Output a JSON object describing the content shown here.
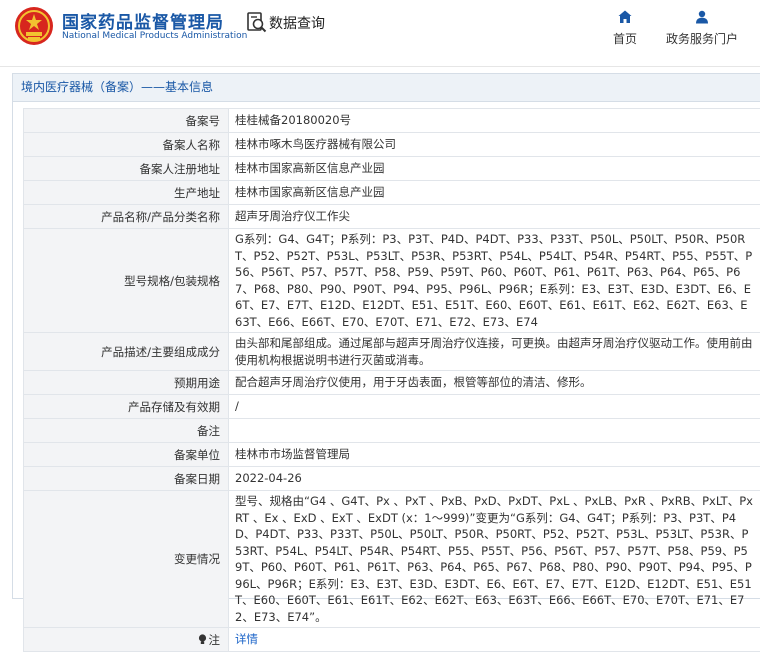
{
  "header": {
    "org_name_cn": "国家药品监督管理局",
    "org_name_en": "National Medical Products Administration",
    "search_label": "数据查询",
    "nav": [
      {
        "label": "首页"
      },
      {
        "label": "政务服务门户"
      }
    ]
  },
  "panel": {
    "title": "境内医疗器械（备案）——基本信息"
  },
  "fields": [
    {
      "label": "备案号",
      "value": "桂桂械备20180020号"
    },
    {
      "label": "备案人名称",
      "value": "桂林市啄木鸟医疗器械有限公司"
    },
    {
      "label": "备案人注册地址",
      "value": "桂林市国家高新区信息产业园"
    },
    {
      "label": "生产地址",
      "value": "桂林市国家高新区信息产业园"
    },
    {
      "label": "产品名称/产品分类名称",
      "value": "超声牙周治疗仪工作尖"
    },
    {
      "label": "型号规格/包装规格",
      "value": "G系列：G4、G4T；P系列：P3、P3T、P4D、P4DT、P33、P33T、P50L、P50LT、P50R、P50RT、P52、P52T、P53L、P53LT、P53R、P53RT、P54L、P54LT、P54R、P54RT、P55、P55T、P56、P56T、P57、P57T、P58、P59、P59T、P60、P60T、P61、P61T、P63、P64、P65、P67、P68、P80、P90、P90T、P94、P95、P96L、P96R；E系列：E3、E3T、E3D、E3DT、E6、E6T、E7、E7T、E12D、E12DT、E51、E51T、E60、E60T、E61、E61T、E62、E62T、E63、E63T、E66、E66T、E70、E70T、E71、E72、E73、E74"
    },
    {
      "label": "产品描述/主要组成成分",
      "value": "由头部和尾部组成。通过尾部与超声牙周治疗仪连接，可更换。由超声牙周治疗仪驱动工作。使用前由使用机构根据说明书进行灭菌或消毒。"
    },
    {
      "label": "预期用途",
      "value": "配合超声牙周治疗仪使用，用于牙齿表面，根管等部位的清洁、修形。"
    },
    {
      "label": "产品存储及有效期",
      "value": "/"
    },
    {
      "label": "备注",
      "value": ""
    },
    {
      "label": "备案单位",
      "value": "桂林市市场监督管理局"
    },
    {
      "label": "备案日期",
      "value": "2022-04-26"
    },
    {
      "label": "变更情况",
      "value": "型号、规格由“G4 、G4T、Px 、PxT 、PxB、PxD、PxDT、PxL 、PxLB、PxR 、PxRB、PxLT、PxRT 、Ex 、ExD 、ExT 、ExDT (x：1～999)”变更为“G系列：G4、G4T；P系列：P3、P3T、P4D、P4DT、P33、P33T、P50L、P50LT、P50R、P50RT、P52、P52T、P53L、P53LT、P53R、P53RT、P54L、P54LT、P54R、P54RT、P55、P55T、P56、P56T、P57、P57T、P58、P59、P59T、P60、P60T、P61、P61T、P63、P64、P65、P67、P68、P80、P90、P90T、P94、P95、P96L、P96R；E系列：E3、E3T、E3D、E3DT、E6、E6T、E7、E7T、E12D、E12DT、E51、E51T、E60、E60T、E61、E61T、E62、E62T、E63、E63T、E66、E66T、E70、E70T、E71、E72、E73、E74”。"
    },
    {
      "label": "注",
      "value": "详情"
    }
  ],
  "colors": {
    "brand_blue": "#1a58a6",
    "link_blue": "#1a63c8",
    "emblem_red": "#d7261e",
    "emblem_gold": "#f2c230"
  },
  "icons": {
    "emblem": "national-emblem-icon",
    "search": "data-query-icon",
    "home": "home-icon",
    "user": "user-icon",
    "note": "bulb-icon"
  }
}
